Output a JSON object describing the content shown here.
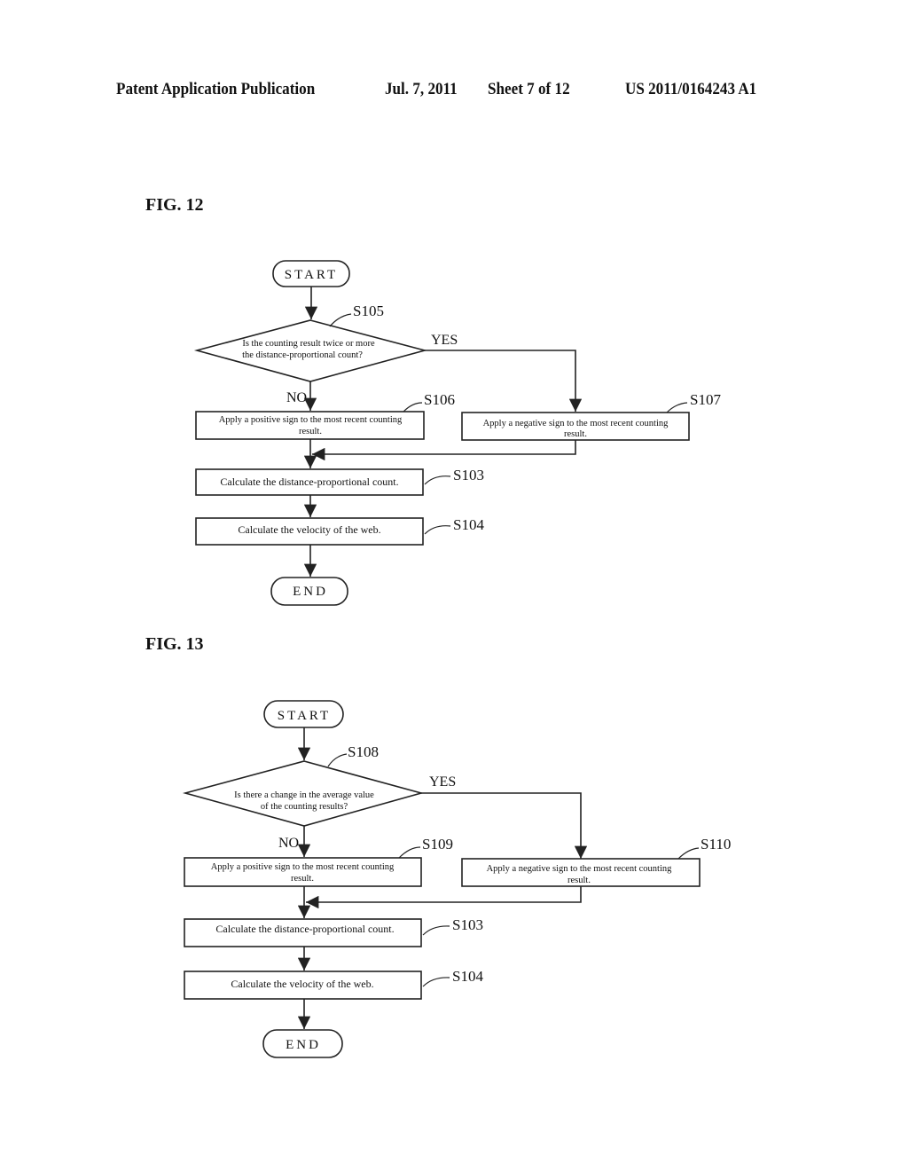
{
  "header": {
    "publication": "Patent Application Publication",
    "date": "Jul. 7, 2011",
    "sheet": "Sheet 7 of 12",
    "number": "US 2011/0164243 A1"
  },
  "figures": [
    {
      "label": "FIG. 12",
      "start": "START",
      "end": "END",
      "decision": {
        "step": "S105",
        "line1": "Is the counting result twice or more",
        "line2": "the distance-proportional count?",
        "yes": "YES",
        "no": "NO"
      },
      "no_branch": {
        "step": "S106",
        "line1": "Apply a positive sign to the most recent counting",
        "line2": "result."
      },
      "yes_branch": {
        "step": "S107",
        "line1": "Apply a negative sign to the most recent counting",
        "line2": "result."
      },
      "calc_count": {
        "step": "S103",
        "text": "Calculate the distance-proportional count."
      },
      "calc_velocity": {
        "step": "S104",
        "text": "Calculate the velocity of the web."
      }
    },
    {
      "label": "FIG. 13",
      "start": "START",
      "end": "END",
      "decision": {
        "step": "S108",
        "line1": "Is there a change in the average value",
        "line2": "of the counting results?",
        "yes": "YES",
        "no": "NO"
      },
      "no_branch": {
        "step": "S109",
        "line1": "Apply a positive sign to the most recent counting",
        "line2": "result."
      },
      "yes_branch": {
        "step": "S110",
        "line1": "Apply a negative sign to the most recent counting",
        "line2": "result."
      },
      "calc_count": {
        "step": "S103",
        "text": "Calculate the distance-proportional count."
      },
      "calc_velocity": {
        "step": "S104",
        "text": "Calculate the velocity of the web."
      }
    }
  ]
}
